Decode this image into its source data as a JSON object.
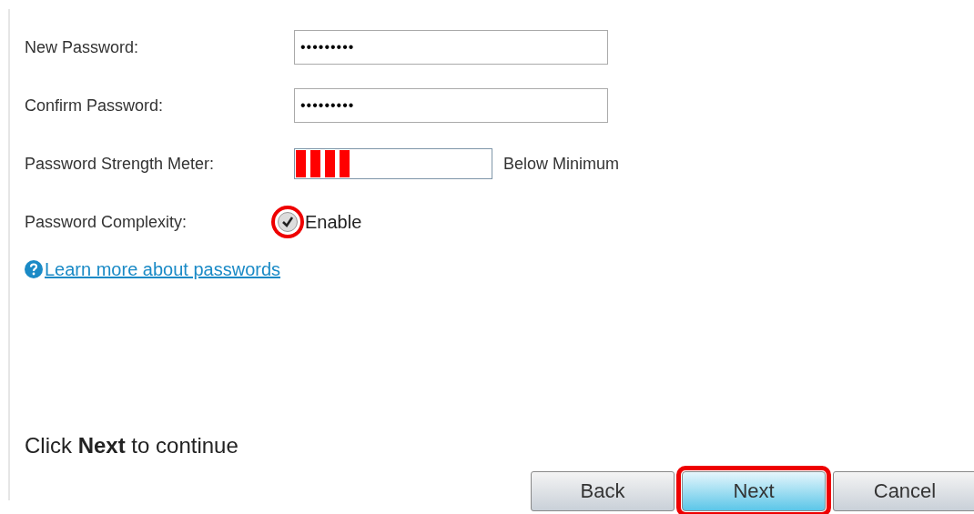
{
  "fields": [
    {
      "label": "New Password:",
      "value": "•••••••••"
    },
    {
      "label": "Confirm Password:",
      "value": "•••••••••"
    }
  ],
  "strength_meter": {
    "label": "Password Strength Meter:",
    "level": 0.28,
    "reading": "Below Minimum"
  },
  "complexity": {
    "label": "Password Complexity:",
    "checkbox_label": "Enable",
    "checked": true,
    "highlighted": true
  },
  "help_link": "Learn more about passwords",
  "instruction": "Click **Next** to continue",
  "buttons": [
    {
      "label": "Back",
      "kind": "plain",
      "highlighted": false
    },
    {
      "label": "Next",
      "kind": "primary",
      "highlighted": true
    },
    {
      "label": "Cancel",
      "kind": "plain",
      "highlighted": false
    }
  ]
}
